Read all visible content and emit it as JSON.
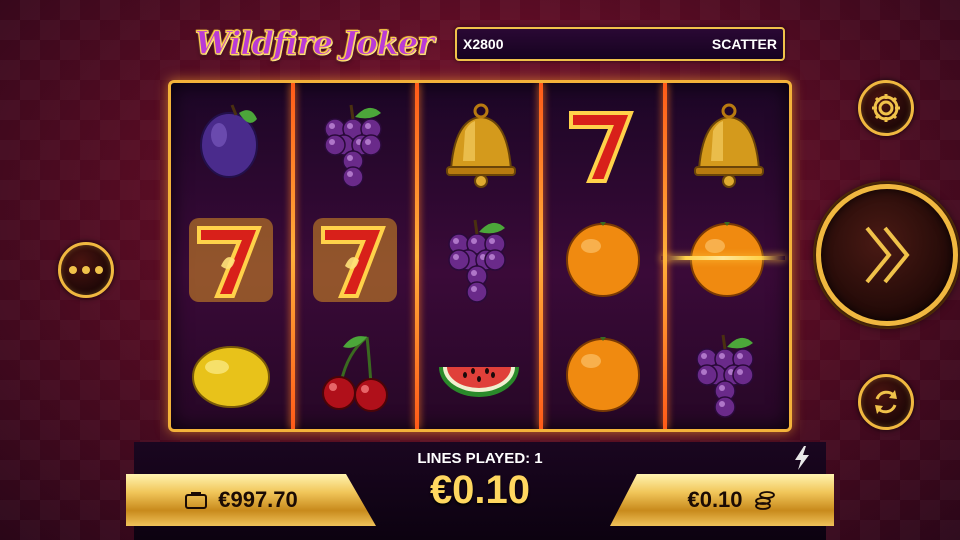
{
  "game": {
    "title": "Wildfire Joker"
  },
  "info_bar": {
    "multiplier": "X2800",
    "symbol_label": "SCATTER"
  },
  "reels": [
    [
      "plum",
      "seven",
      "lemon"
    ],
    [
      "grapes",
      "seven",
      "cherries"
    ],
    [
      "bell",
      "grapes",
      "watermelon"
    ],
    [
      "seven",
      "orange",
      "orange"
    ],
    [
      "bell",
      "orange",
      "grapes"
    ]
  ],
  "footer": {
    "lines_played": "LINES PLAYED: 1",
    "total_bet": "€0.10",
    "balance": "€997.70",
    "bet": "€0.10"
  },
  "icons": {
    "menu": "menu-dots-icon",
    "settings": "gear-icon",
    "spin": "double-chevron-right-icon",
    "autoplay": "refresh-icon",
    "turbo": "lightning-icon",
    "wallet": "wallet-icon",
    "coins": "coin-stack-icon"
  },
  "colors": {
    "gold": "#f0c24a",
    "reel_separator": "#ff7a20",
    "background": "#5a0c24"
  }
}
